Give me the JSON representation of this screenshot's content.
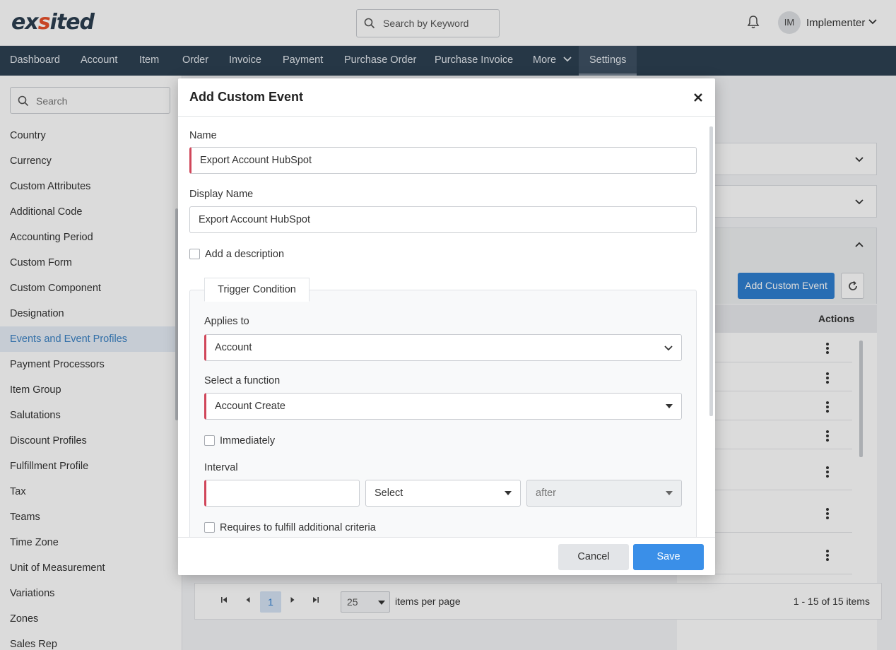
{
  "header": {
    "logo_text_a": "ex",
    "logo_text_accent": "s",
    "logo_text_b": "ited",
    "search_placeholder": "Search by Keyword",
    "user_initials": "IM",
    "user_name": "Implementer"
  },
  "nav": {
    "items": [
      "Dashboard",
      "Account",
      "Item",
      "Order",
      "Invoice",
      "Payment",
      "Purchase Order",
      "Purchase Invoice",
      "More",
      "Settings"
    ],
    "active": "Settings"
  },
  "sidebar": {
    "search_placeholder": "Search",
    "items": [
      "Country",
      "Currency",
      "Custom Attributes",
      "Additional Code",
      "Accounting Period",
      "Custom Form",
      "Custom Component",
      "Designation",
      "Events and Event Profiles",
      "Payment Processors",
      "Item Group",
      "Salutations",
      "Discount Profiles",
      "Fulfillment Profile",
      "Tax",
      "Teams",
      "Time Zone",
      "Unit of Measurement",
      "Variations",
      "Zones",
      "Sales Rep"
    ],
    "active": "Events and Event Profiles"
  },
  "background": {
    "add_button": "Add Custom Event",
    "actions_header": "Actions",
    "pager": {
      "current_page": "1",
      "page_size": "25",
      "page_size_label": "items per page",
      "count": "1 - 15 of 15 items"
    }
  },
  "modal": {
    "title": "Add Custom Event",
    "name_label": "Name",
    "name_value": "Export Account HubSpot",
    "display_name_label": "Display Name",
    "display_name_value": "Export Account HubSpot",
    "add_description_label": "Add a description",
    "trigger_tab": "Trigger Condition",
    "applies_to_label": "Applies to",
    "applies_to_value": "Account",
    "function_label": "Select a function",
    "function_value": "Account Create",
    "immediately_label": "Immediately",
    "interval_label": "Interval",
    "interval_value": "",
    "interval_unit": "Select",
    "interval_relation": "after",
    "additional_criteria_label": "Requires to fulfill additional criteria",
    "cancel_label": "Cancel",
    "save_label": "Save"
  },
  "colors": {
    "nav_bg": "#2d4052",
    "primary": "#3a8fe8",
    "required": "#d0465a",
    "logo_accent": "#e8502a"
  }
}
